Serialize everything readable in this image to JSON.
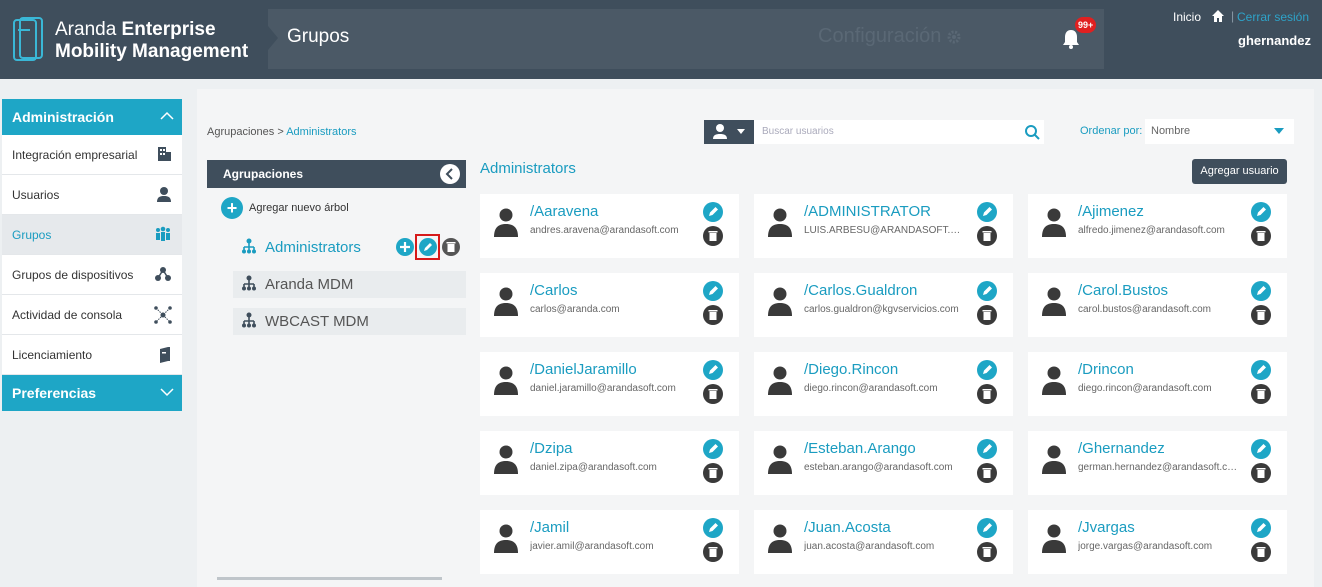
{
  "brand": {
    "line1_light": "Aranda ",
    "line1_bold": "Enterprise",
    "line2": "Mobility Management"
  },
  "header": {
    "title": "Grupos",
    "config_label": "Configuración",
    "notifications_badge": "99+",
    "inicio": "Inicio",
    "separator": "|",
    "logout": "Cerrar sesión",
    "username": "ghernandez"
  },
  "sidebar": {
    "admin_header": "Administración",
    "items": [
      {
        "label": "Integración empresarial",
        "icon": "building-icon"
      },
      {
        "label": "Usuarios",
        "icon": "user-icon"
      },
      {
        "label": "Grupos",
        "icon": "group-icon",
        "active": true
      },
      {
        "label": "Grupos de dispositivos",
        "icon": "device-group-icon"
      },
      {
        "label": "Actividad de consola",
        "icon": "activity-icon"
      },
      {
        "label": "Licenciamiento",
        "icon": "license-icon"
      }
    ],
    "prefs_header": "Preferencias"
  },
  "breadcrumb": {
    "root": "Agrupaciones",
    "arrow": " > ",
    "current": "Administrators"
  },
  "search": {
    "placeholder": "Buscar usuarios"
  },
  "sort": {
    "label": "Ordenar por:",
    "value": "Nombre"
  },
  "tree": {
    "title": "Agrupaciones",
    "add_label": "Agregar nuevo árbol",
    "nodes": [
      {
        "label": "Administrators",
        "selected": true
      },
      {
        "label": "Aranda MDM"
      },
      {
        "label": "WBCAST MDM"
      }
    ]
  },
  "users": {
    "title": "Administrators",
    "add_button": "Agregar usuario",
    "list": [
      {
        "name": "/Aaravena",
        "email": "andres.aravena@arandasoft.com"
      },
      {
        "name": "/ADMINISTRATOR",
        "email": "LUIS.ARBESU@ARANDASOFT.COM"
      },
      {
        "name": "/Ajimenez",
        "email": "alfredo.jimenez@arandasoft.com"
      },
      {
        "name": "/Carlos",
        "email": "carlos@aranda.com"
      },
      {
        "name": "/Carlos.Gualdron",
        "email": "carlos.gualdron@kgvservicios.com"
      },
      {
        "name": "/Carol.Bustos",
        "email": "carol.bustos@arandasoft.com"
      },
      {
        "name": "/DanielJaramillo",
        "email": "daniel.jaramillo@arandasoft.com"
      },
      {
        "name": "/Diego.Rincon",
        "email": "diego.rincon@arandasoft.com"
      },
      {
        "name": "/Drincon",
        "email": "diego.rincon@arandasoft.com"
      },
      {
        "name": "/Dzipa",
        "email": "daniel.zipa@arandasoft.com"
      },
      {
        "name": "/Esteban.Arango",
        "email": "esteban.arango@arandasoft.com"
      },
      {
        "name": "/Ghernandez",
        "email": "german.hernandez@arandasoft.com"
      },
      {
        "name": "/Jamil",
        "email": "javier.amil@arandasoft.com"
      },
      {
        "name": "/Juan.Acosta",
        "email": "juan.acosta@arandasoft.com"
      },
      {
        "name": "/Jvargas",
        "email": "jorge.vargas@arandasoft.com"
      }
    ]
  },
  "colors": {
    "accent": "#1ea6c6",
    "header_bg": "#3f4e5c",
    "highlight": "#d61a1a"
  }
}
